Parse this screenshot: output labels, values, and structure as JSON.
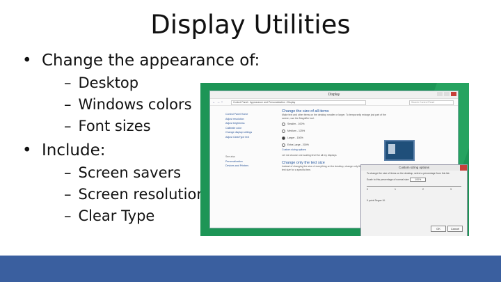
{
  "slide": {
    "title": "Display Utilities",
    "bullets": [
      {
        "text": "Change the appearance of:",
        "subs": [
          "Desktop",
          "Windows colors",
          "Font sizes"
        ]
      },
      {
        "text": "Include:",
        "subs": [
          "Screen savers",
          "Screen resolution",
          "Clear Type"
        ]
      }
    ],
    "sub_dash": "–"
  },
  "colors": {
    "bottom_bar": "#3a5f9f",
    "screenshot_bg": "#1d9556",
    "link": "#2a5599"
  },
  "screenshot": {
    "window_title": "Display",
    "address": "Control Panel › Appearance and Personalization › Display",
    "search_placeholder": "Search Control Panel",
    "nav_arrows": "← → ↑",
    "left_nav": [
      "Control Panel Home",
      "Adjust resolution",
      "Adjust brightness",
      "Calibrate color",
      "Change display settings",
      "Adjust ClearType text"
    ],
    "left_nav_bottom_label": "See also",
    "left_nav_bottom": [
      "Personalization",
      "Devices and Printers"
    ],
    "heading": "Change the size of all items",
    "description": "Make text and other items on the desktop smaller or larger. To temporarily enlarge just part of the screen, use the Magnifier tool.",
    "options": [
      "Smaller - 100%",
      "Medium - 125%",
      "Larger - 150%",
      "Extra Large - 200%"
    ],
    "custom_link": "Custom sizing options",
    "checkbox_text": "Let me choose one scaling level for all my displays",
    "heading2": "Change only the text size",
    "description2": "Instead of changing the size of everything on the desktop, change only the text size for a specific item.",
    "dialog": {
      "title": "Custom sizing options",
      "text": "To change the size of items on the desktop, select a percentage from this list.",
      "scale_label": "Scale to this percentage of normal size:",
      "scale_value": "100%",
      "ruler_labels": [
        "0",
        "1",
        "2",
        "3"
      ],
      "sample": "9 point Segoe UI.",
      "ok": "OK",
      "cancel": "Cancel"
    }
  }
}
